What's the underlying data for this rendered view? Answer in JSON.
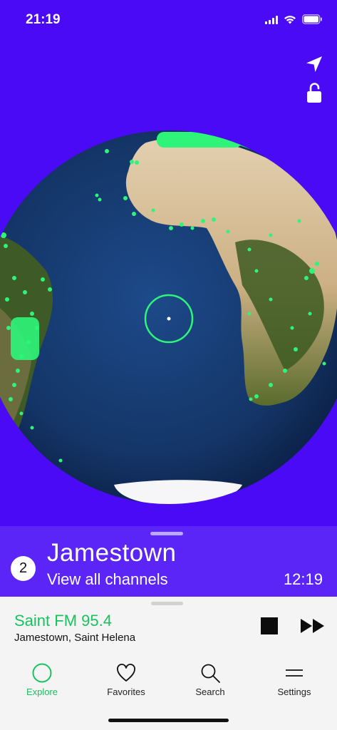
{
  "status_bar": {
    "time": "21:19"
  },
  "location": {
    "channel_count": "2",
    "city": "Jamestown",
    "view_all": "View all channels",
    "local_time": "12:19"
  },
  "player": {
    "station": "Saint FM 95.4",
    "location": "Jamestown, Saint Helena"
  },
  "tabs": [
    {
      "label": "Explore",
      "icon": "circle-icon",
      "active": true
    },
    {
      "label": "Favorites",
      "icon": "heart-icon",
      "active": false
    },
    {
      "label": "Search",
      "icon": "search-icon",
      "active": false
    },
    {
      "label": "Settings",
      "icon": "menu-icon",
      "active": false
    }
  ],
  "colors": {
    "background": "#4a0af5",
    "panel": "#5b25f7",
    "accent_green": "#19c25e",
    "station_dot_green": "#2ef57a"
  }
}
